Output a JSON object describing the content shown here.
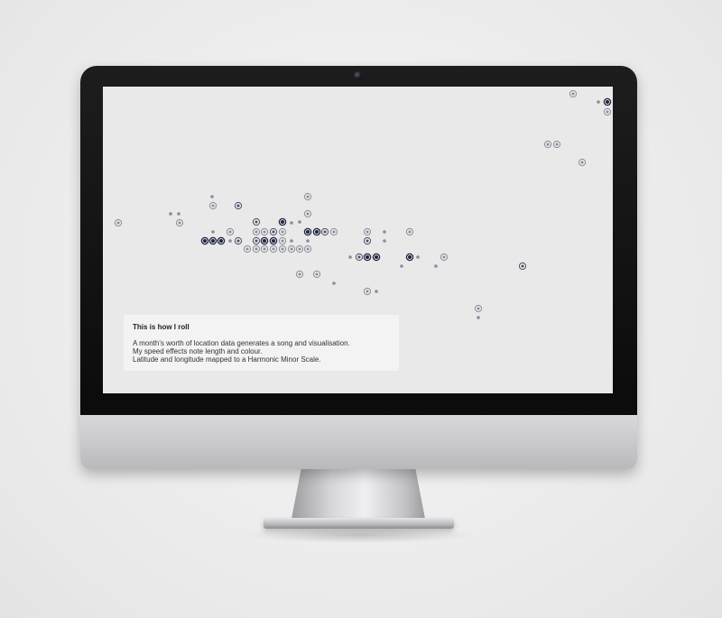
{
  "info_panel": {
    "title": "This is how I roll",
    "lines": [
      "A month's worth of location data generates a song and visualisation.",
      "My speed effects note length and colour.",
      "Latitude and longitude mapped to a Harmonic Minor Scale."
    ]
  },
  "colors": {
    "screen_background": "#e9e9e9",
    "note_dark": "#1f2340",
    "note_mid": "#4a4d66",
    "note_light": "#8a8c99",
    "panel_background": "#f3f3f3"
  },
  "icons": {
    "camera": "camera-icon",
    "note": "note-circle-icon"
  }
}
